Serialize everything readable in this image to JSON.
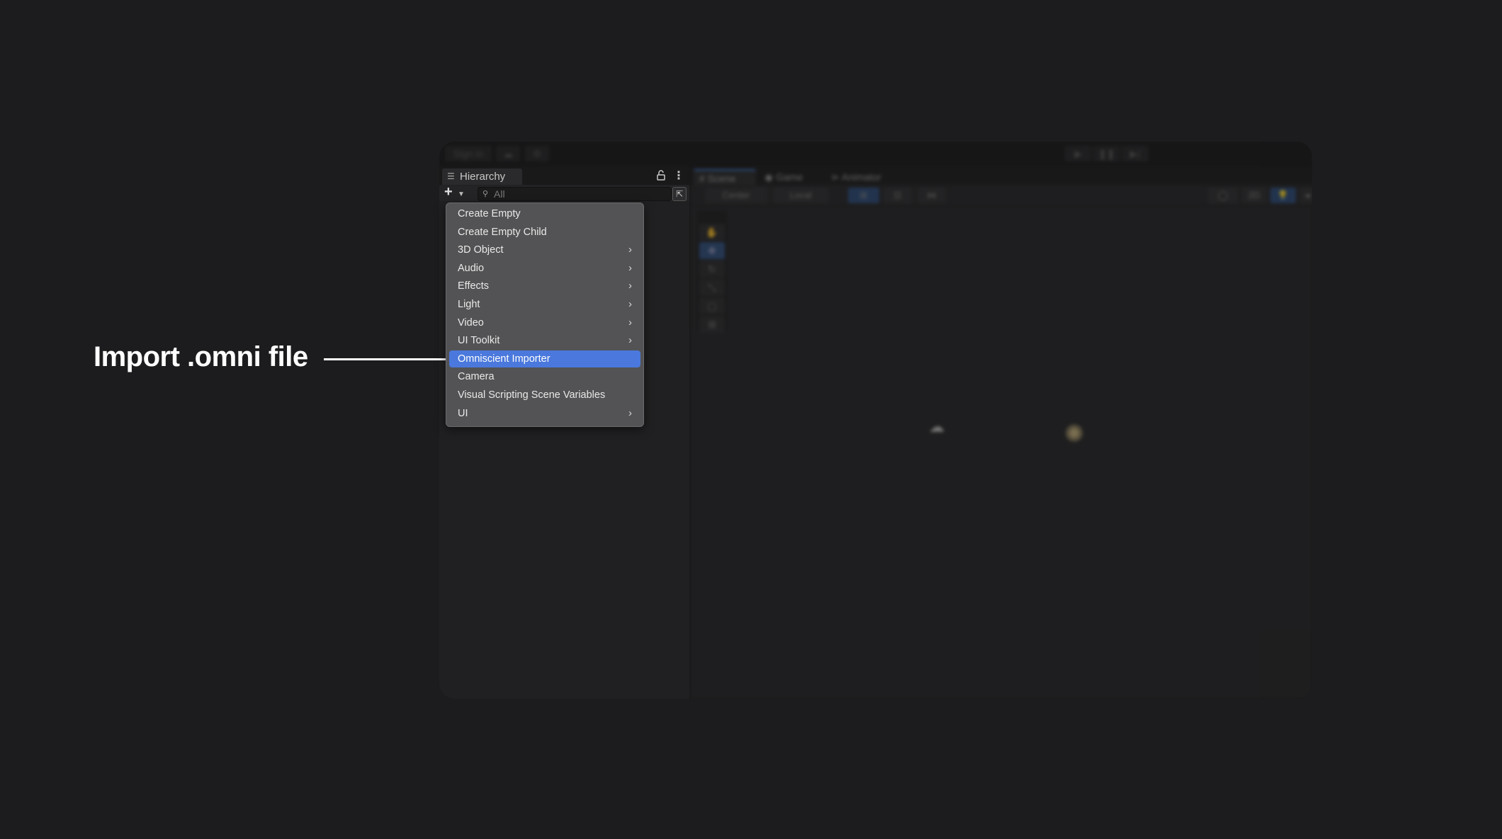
{
  "annotation": {
    "label": "Import .omni file"
  },
  "topbar": {
    "sign_in_label": "Sign in",
    "cloud_icon": "cloud-icon",
    "settings_icon": "gear-icon",
    "play_icon": "▶",
    "pause_icon": "❚❚",
    "step_icon": "▶|"
  },
  "hierarchy": {
    "tab_label": "Hierarchy",
    "tab_icon": "☰",
    "lock_icon": "🔓",
    "kebab_icon": "⋮",
    "add_icon": "+",
    "add_caret": "▼",
    "search_icon": "⚲",
    "search_placeholder": "All",
    "search_value": "",
    "popout_icon": "⇱"
  },
  "scene": {
    "tabs": [
      {
        "label": "Scene",
        "icon": "#",
        "active": true
      },
      {
        "label": "Game",
        "icon": "◉",
        "active": false
      },
      {
        "label": "Animator",
        "icon": "⋗",
        "active": false
      }
    ],
    "toolbar": {
      "pivot_label": "Center",
      "space_label": "Local",
      "mode_2d_label": "2D"
    },
    "tools": [
      "✋",
      "✥",
      "↻",
      "⤡",
      "▢",
      "⊞"
    ]
  },
  "context_menu": {
    "items": [
      {
        "label": "Create Empty",
        "submenu": false,
        "selected": false
      },
      {
        "label": "Create Empty Child",
        "submenu": false,
        "selected": false
      },
      {
        "label": "3D Object",
        "submenu": true,
        "selected": false
      },
      {
        "label": "Audio",
        "submenu": true,
        "selected": false
      },
      {
        "label": "Effects",
        "submenu": true,
        "selected": false
      },
      {
        "label": "Light",
        "submenu": true,
        "selected": false
      },
      {
        "label": "Video",
        "submenu": true,
        "selected": false
      },
      {
        "label": "UI Toolkit",
        "submenu": true,
        "selected": false
      },
      {
        "label": "Omniscient Importer",
        "submenu": false,
        "selected": true
      },
      {
        "label": "Camera",
        "submenu": false,
        "selected": false
      },
      {
        "label": "Visual Scripting Scene Variables",
        "submenu": false,
        "selected": false
      },
      {
        "label": "UI",
        "submenu": true,
        "selected": false
      }
    ],
    "chevron": "›"
  },
  "colors": {
    "background": "#1c1c1e",
    "menu_bg": "#535355",
    "selected_bg": "#4a78dc",
    "accent_blue": "#3a79d6",
    "sun_gizmo": "#c8b27a"
  }
}
